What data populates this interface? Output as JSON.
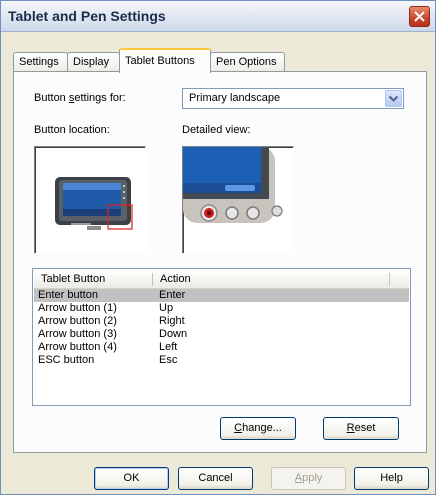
{
  "window": {
    "title": "Tablet and Pen Settings"
  },
  "tabs": [
    {
      "label": "Settings"
    },
    {
      "label": "Display"
    },
    {
      "label": "Tablet Buttons"
    },
    {
      "label": "Pen Options"
    }
  ],
  "active_tab": "Tablet Buttons",
  "button_settings": {
    "label_prefix": "Button ",
    "label_mnemonic": "s",
    "label_suffix": "ettings for:",
    "selected": "Primary landscape"
  },
  "button_location_label": "Button location:",
  "detailed_view_label": "Detailed view:",
  "list": {
    "columns": [
      "Tablet Button",
      "Action"
    ],
    "rows": [
      {
        "button": "Enter button",
        "action": "Enter",
        "selected": true
      },
      {
        "button": "Arrow button (1)",
        "action": "Up"
      },
      {
        "button": "Arrow button (2)",
        "action": "Right"
      },
      {
        "button": "Arrow button (3)",
        "action": "Down"
      },
      {
        "button": "Arrow button (4)",
        "action": "Left"
      },
      {
        "button": "ESC button",
        "action": "Esc"
      }
    ]
  },
  "buttons": {
    "change_mnemonic": "C",
    "change_rest": "hange...",
    "reset_mnemonic": "R",
    "reset_rest": "eset",
    "ok": "OK",
    "cancel": "Cancel",
    "apply_mnemonic": "A",
    "apply_rest": "pply",
    "help": "Help"
  },
  "colors": {
    "dialog_bg": "#ece9d8",
    "active_tab_accent": "#ffc83c",
    "selected_row": "#c1c1c1",
    "close_button": "#c9452a"
  }
}
